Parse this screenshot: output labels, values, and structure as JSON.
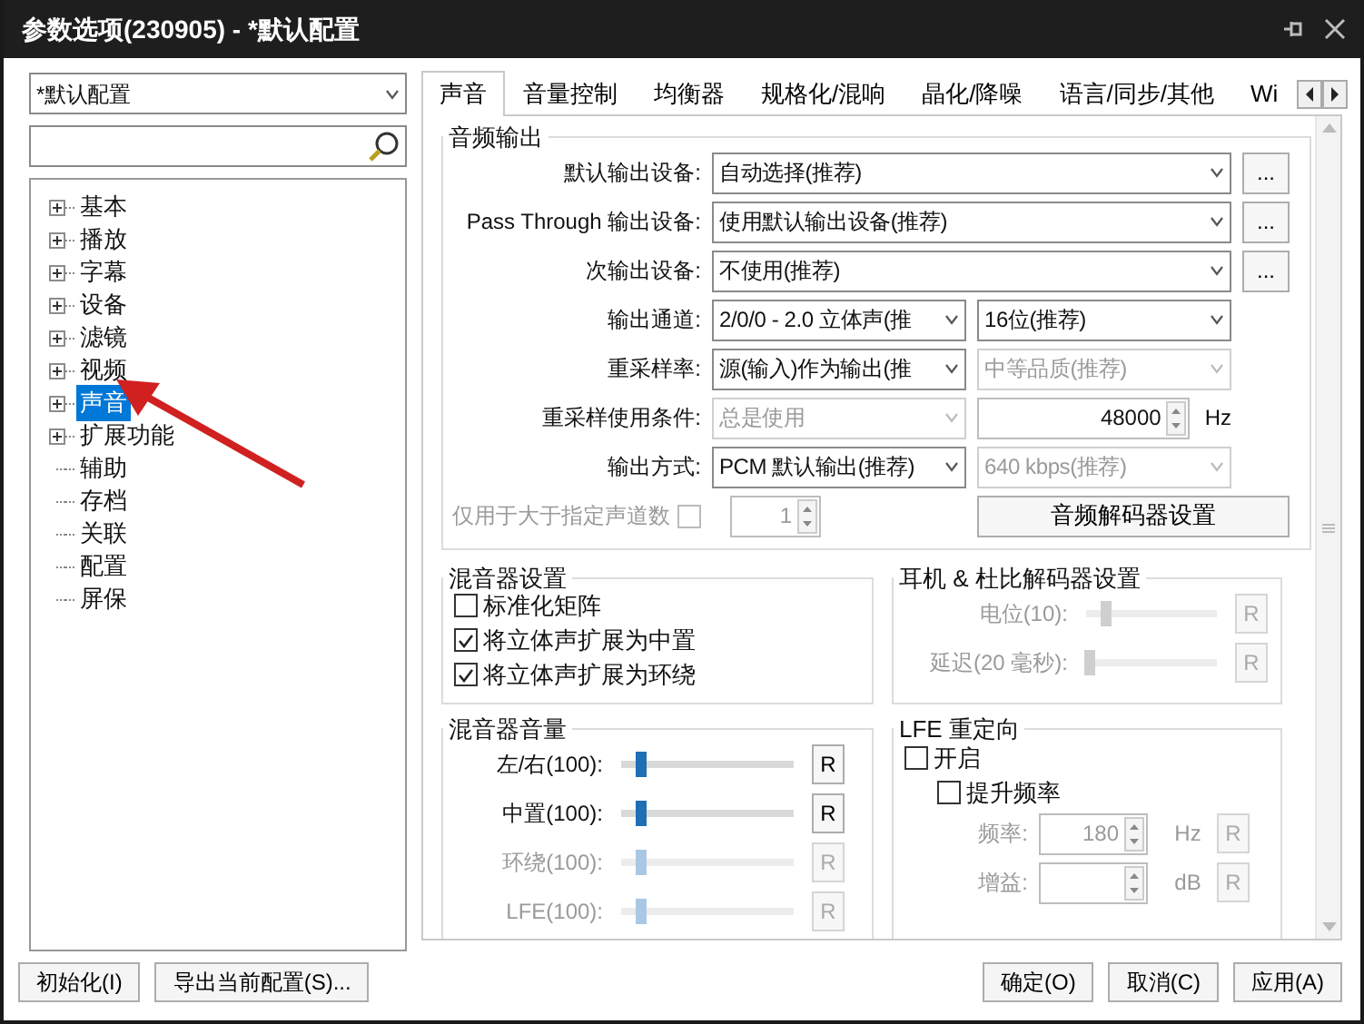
{
  "window": {
    "title": "参数选项(230905) - *默认配置"
  },
  "profile": {
    "value": "*默认配置"
  },
  "tree": [
    {
      "label": "基本",
      "expandable": true,
      "selected": false
    },
    {
      "label": "播放",
      "expandable": true,
      "selected": false
    },
    {
      "label": "字幕",
      "expandable": true,
      "selected": false
    },
    {
      "label": "设备",
      "expandable": true,
      "selected": false
    },
    {
      "label": "滤镜",
      "expandable": true,
      "selected": false
    },
    {
      "label": "视频",
      "expandable": true,
      "selected": false
    },
    {
      "label": "声音",
      "expandable": true,
      "selected": true
    },
    {
      "label": "扩展功能",
      "expandable": true,
      "selected": false
    },
    {
      "label": "辅助",
      "expandable": false,
      "selected": false
    },
    {
      "label": "存档",
      "expandable": false,
      "selected": false
    },
    {
      "label": "关联",
      "expandable": false,
      "selected": false
    },
    {
      "label": "配置",
      "expandable": false,
      "selected": false
    },
    {
      "label": "屏保",
      "expandable": false,
      "selected": false
    }
  ],
  "tabs": [
    {
      "label": "声音",
      "selected": true
    },
    {
      "label": "音量控制",
      "selected": false
    },
    {
      "label": "均衡器",
      "selected": false
    },
    {
      "label": "规格化/混响",
      "selected": false
    },
    {
      "label": "晶化/降噪",
      "selected": false
    },
    {
      "label": "语言/同步/其他",
      "selected": false
    },
    {
      "label": "Wi",
      "selected": false
    }
  ],
  "audio_output": {
    "title": "音频输出",
    "rows": [
      {
        "label": "默认输出设备:",
        "more_button": "...",
        "fields": [
          {
            "kind": "select",
            "value": "自动选择(推荐)",
            "disabled": false,
            "wide": true
          }
        ]
      },
      {
        "label": "Pass Through 输出设备:",
        "more_button": "...",
        "fields": [
          {
            "kind": "select",
            "value": "使用默认输出设备(推荐)",
            "disabled": false,
            "wide": true
          }
        ]
      },
      {
        "label": "次输出设备:",
        "more_button": "...",
        "fields": [
          {
            "kind": "select",
            "value": "不使用(推荐)",
            "disabled": false,
            "wide": true
          }
        ]
      },
      {
        "label": "输出通道:",
        "fields": [
          {
            "kind": "select",
            "value": "2/0/0 - 2.0 立体声(推",
            "disabled": false,
            "wide": false
          },
          {
            "kind": "select",
            "value": "16位(推荐)",
            "disabled": false,
            "wide": false
          }
        ]
      },
      {
        "label": "重采样率:",
        "fields": [
          {
            "kind": "select",
            "value": "源(输入)作为输出(推",
            "disabled": false,
            "wide": false
          },
          {
            "kind": "select",
            "value": "中等品质(推荐)",
            "disabled": true,
            "wide": false
          }
        ]
      },
      {
        "label": "重采样使用条件:",
        "fields": [
          {
            "kind": "select",
            "value": "总是使用",
            "disabled": true,
            "wide": false
          },
          {
            "kind": "spin",
            "value": "48000",
            "unit": "Hz",
            "disabled": false,
            "wide": false
          }
        ]
      },
      {
        "label": "输出方式:",
        "fields": [
          {
            "kind": "select",
            "value": "PCM 默认输出(推荐)",
            "disabled": false,
            "wide": false
          },
          {
            "kind": "select",
            "value": "640 kbps(推荐)",
            "disabled": true,
            "wide": false
          }
        ]
      }
    ],
    "channel_limit": {
      "label": "仅用于大于指定声道数",
      "checked": false,
      "disabled": true,
      "value": "1"
    },
    "decoder_button": "音频解码器设置"
  },
  "mixer_settings": {
    "title": "混音器设置",
    "options": [
      {
        "label": "标准化矩阵",
        "checked": false
      },
      {
        "label": "将立体声扩展为中置",
        "checked": true
      },
      {
        "label": "将立体声扩展为环绕",
        "checked": true
      }
    ]
  },
  "headphone": {
    "title": "耳机 & 杜比解码器设置",
    "sliders": [
      {
        "label": "电位(10):",
        "level": 0.15,
        "disabled": true,
        "reset": "R"
      },
      {
        "label": "延迟(20 毫秒):",
        "level": 0.03,
        "disabled": true,
        "reset": "R"
      }
    ]
  },
  "mixer_volume": {
    "title": "混音器音量",
    "sliders": [
      {
        "label": "左/右(100):",
        "level": 0.12,
        "disabled": false,
        "reset": "R"
      },
      {
        "label": "中置(100):",
        "level": 0.12,
        "disabled": false,
        "reset": "R"
      },
      {
        "label": "环绕(100):",
        "level": 0.12,
        "disabled": true,
        "reset": "R"
      },
      {
        "label": "LFE(100):",
        "level": 0.12,
        "disabled": true,
        "reset": "R"
      }
    ]
  },
  "lfe": {
    "title": "LFE 重定向",
    "options": [
      {
        "label": "开启",
        "checked": false,
        "indent": false
      },
      {
        "label": "提升频率",
        "checked": false,
        "indent": true
      }
    ],
    "spins": [
      {
        "label": "频率:",
        "value": "180",
        "unit": "Hz",
        "reset": "R"
      },
      {
        "label": "增益:",
        "unit": "dB",
        "reset": "R"
      }
    ]
  },
  "footer": {
    "left_buttons": [
      "初始化(I)",
      "导出当前配置(S)..."
    ],
    "right_buttons": [
      "确定(O)",
      "取消(C)",
      "应用(A)"
    ]
  }
}
